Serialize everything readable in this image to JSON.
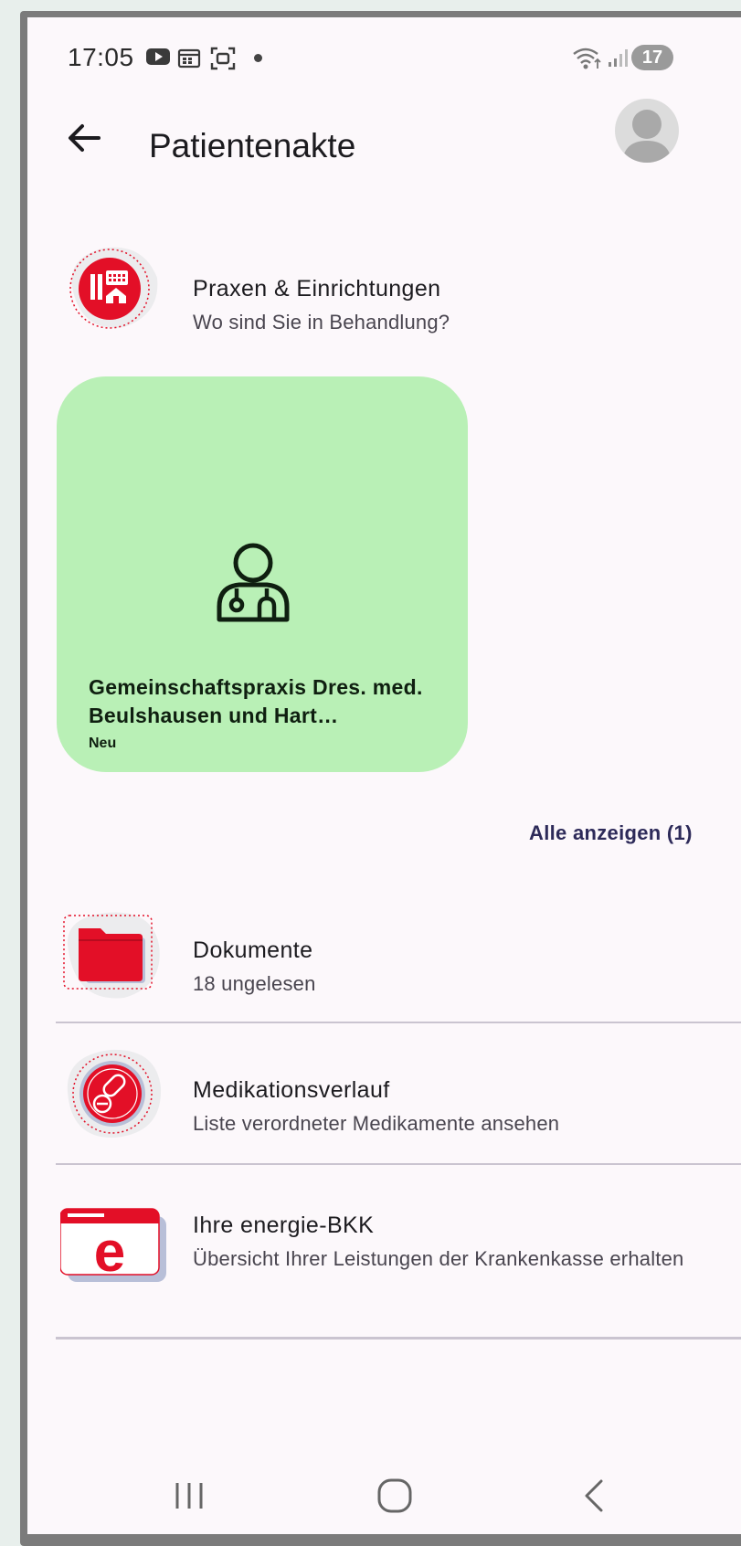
{
  "status_bar": {
    "time": "17:05",
    "battery": "17",
    "icons": [
      "youtube-icon",
      "calendar-icon",
      "screenshot-icon",
      "wifi-icon",
      "signal-icon"
    ]
  },
  "app_bar": {
    "title": "Patientenakte"
  },
  "sections": {
    "praxen": {
      "title": "Praxen & Einrichtungen",
      "subtitle": "Wo sind Sie in Behandlung?"
    },
    "card": {
      "title": "Gemeinschaftspraxis Dres. med. Beulshausen und Hart…",
      "badge": "Neu"
    },
    "show_all": "Alle anzeigen (1)",
    "dokumente": {
      "title": "Dokumente",
      "subtitle": "18 ungelesen"
    },
    "medikation": {
      "title": "Medikationsverlauf",
      "subtitle": "Liste verordneter Medikamente ansehen"
    },
    "bkk": {
      "title": "Ihre energie-BKK",
      "subtitle": "Übersicht Ihrer Leistungen der Krankenkasse erhalten"
    }
  },
  "colors": {
    "accent_red": "#e30f27",
    "card_green": "#b9f0b6",
    "link": "#2d2a59",
    "background": "#fcf8fb"
  }
}
